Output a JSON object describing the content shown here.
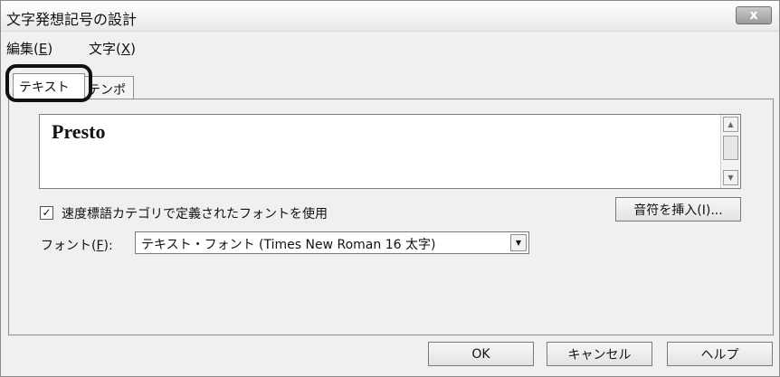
{
  "window": {
    "title": "文字発想記号の設計",
    "close_label": "x"
  },
  "menu": [
    {
      "label": "編集(",
      "mnemonic": "E",
      "suffix": ")"
    },
    {
      "label": "文字(",
      "mnemonic": "X",
      "suffix": ")"
    }
  ],
  "tabs": [
    {
      "label": "テキスト",
      "active": true
    },
    {
      "label": "テンポ",
      "active": false
    }
  ],
  "text_panel": {
    "value": "Presto"
  },
  "insert_note_button": "音符を挿入(I)...",
  "use_font_checkbox": {
    "checked": true,
    "check_mark": "✓",
    "label": "速度標語カテゴリで定義されたフォントを使用"
  },
  "font": {
    "label": "フォント(",
    "mnemonic": "F",
    "suffix": "):",
    "selected": "テキスト・フォント (Times New Roman 16 太字)"
  },
  "footer": {
    "ok": "OK",
    "cancel": "キャンセル",
    "help": "ヘルプ"
  },
  "colors": {
    "window_bg": "#f0f0f0",
    "highlight_ring": "#111111"
  }
}
